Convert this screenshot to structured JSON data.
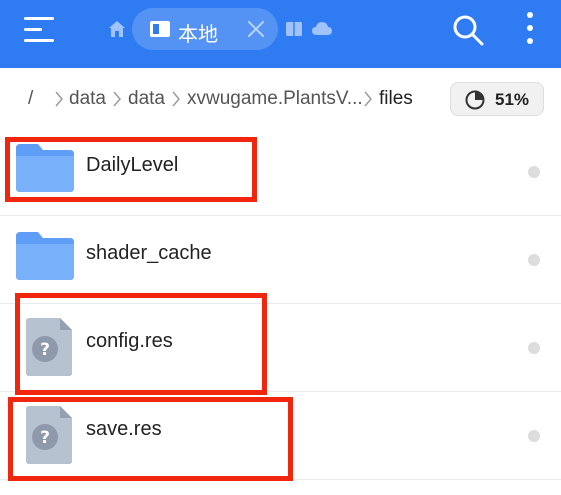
{
  "topbar": {
    "background_color": "#2f7cf2",
    "menu_icon": "hamburger-menu-icon",
    "home_icon": "home-icon",
    "active_tab": {
      "label": "本地",
      "icon": "storage-folder-icon",
      "close_icon": "close-icon"
    },
    "other_tabs": [
      {
        "icon": "book-icon"
      },
      {
        "icon": "cloud-icon"
      }
    ],
    "search_icon": "search-icon",
    "more_icon": "more-vertical-icon"
  },
  "breadcrumb": {
    "root": "/",
    "segments": [
      "data",
      "data",
      "xvwugame.PlantsV...",
      "files"
    ],
    "separator_icon": "chevron-right-icon"
  },
  "storage": {
    "percent_label": "51%",
    "icon": "pie-chart-icon"
  },
  "files": [
    {
      "name": "DailyLevel",
      "type": "folder",
      "icon": "folder-icon"
    },
    {
      "name": "shader_cache",
      "type": "folder",
      "icon": "folder-icon"
    },
    {
      "name": "config.res",
      "type": "file",
      "icon": "unknown-file-icon"
    },
    {
      "name": "save.res",
      "type": "file",
      "icon": "unknown-file-icon"
    }
  ],
  "highlight_color": "#f0260f",
  "highlighted_rows": [
    "DailyLevel",
    "config.res",
    "save.res"
  ]
}
